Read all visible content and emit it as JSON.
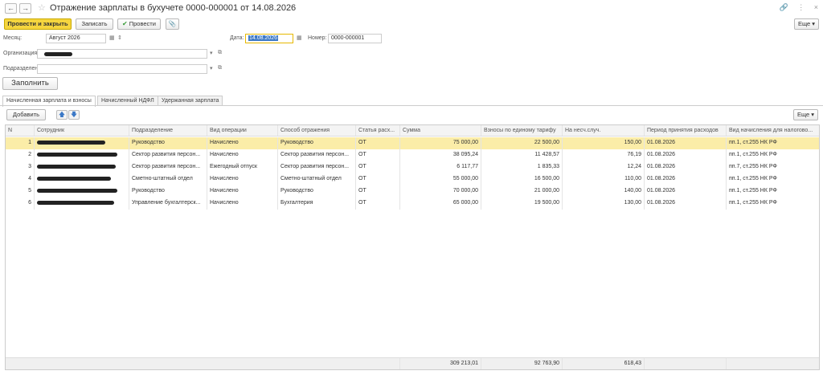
{
  "window": {
    "back": "←",
    "forward": "→",
    "star": "☆",
    "title": "Отражение зарплаты в бухучете 0000-000001 от 14.08.2026",
    "icons": [
      "link-icon",
      "more-icon",
      "close-icon"
    ],
    "link_glyph": "🔗",
    "more_glyph": "⋮",
    "close_glyph": "×"
  },
  "toolbar": {
    "post_close": "Провести и закрыть",
    "save": "Записать",
    "post": "Провести",
    "post_icon": "✔",
    "attach_icon": "📎",
    "more": "Еще",
    "more_arrow": "▾"
  },
  "form": {
    "month_label": "Месяц:",
    "month_value": "Август 2026",
    "date_label": "Дата:",
    "date_value": "14.08.2026",
    "number_label": "Номер:",
    "number_value": "0000-000001",
    "org_label": "Организация:",
    "dept_label": "Подразделение:",
    "fill_button": "Заполнить",
    "calendar_glyph": "▦",
    "dropdown_glyph": "▾",
    "open_glyph": "⧉"
  },
  "tabs": [
    {
      "label": "Начисленная зарплата и взносы"
    },
    {
      "label": "Начисленный НДФЛ"
    },
    {
      "label": "Удержанная зарплата"
    }
  ],
  "table_toolbar": {
    "add": "Добавить",
    "up": "🡅",
    "down": "🡇",
    "more": "Еще",
    "more_arrow": "▾"
  },
  "table": {
    "columns": [
      "N",
      "Сотрудник",
      "Подразделение",
      "Вид операции",
      "Способ отражения",
      "Статья расх...",
      "Сумма",
      "Взносы по единому тарифу",
      "На несч.случ.",
      "Период принятия расходов",
      "Вид начисления для налогово..."
    ],
    "rows": [
      {
        "n": "1",
        "dept": "Руководство",
        "op": "Начислено",
        "method": "Руководство",
        "item": "ОТ",
        "sum": "75 000,00",
        "contrib": "22 500,00",
        "accident": "150,00",
        "period": "01.08.2026",
        "tax": "пп.1, ст.255 НК РФ"
      },
      {
        "n": "2",
        "dept": "Сектор развития персон...",
        "op": "Начислено",
        "method": "Сектор развития персон...",
        "item": "ОТ",
        "sum": "38 095,24",
        "contrib": "11 428,57",
        "accident": "76,19",
        "period": "01.08.2026",
        "tax": "пп.1, ст.255 НК РФ"
      },
      {
        "n": "3",
        "dept": "Сектор развития персон...",
        "op": "Ежегодный отпуск",
        "method": "Сектор развития персон...",
        "item": "ОТ",
        "sum": "6 117,77",
        "contrib": "1 835,33",
        "accident": "12,24",
        "period": "01.08.2026",
        "tax": "пп.7, ст.255 НК РФ"
      },
      {
        "n": "4",
        "dept": "Сметно-штатный отдел",
        "op": "Начислено",
        "method": "Сметно-штатный отдел",
        "item": "ОТ",
        "sum": "55 000,00",
        "contrib": "16 500,00",
        "accident": "110,00",
        "period": "01.08.2026",
        "tax": "пп.1, ст.255 НК РФ"
      },
      {
        "n": "5",
        "dept": "Руководство",
        "op": "Начислено",
        "method": "Руководство",
        "item": "ОТ",
        "sum": "70 000,00",
        "contrib": "21 000,00",
        "accident": "140,00",
        "period": "01.08.2026",
        "tax": "пп.1, ст.255 НК РФ"
      },
      {
        "n": "6",
        "dept": "Управление бухгалтерск...",
        "op": "Начислено",
        "method": "Бухгалтерия",
        "item": "ОТ",
        "sum": "65 000,00",
        "contrib": "19 500,00",
        "accident": "130,00",
        "period": "01.08.2026",
        "tax": "пп.1, ст.255 НК РФ"
      }
    ],
    "totals": {
      "sum": "309 213,01",
      "contrib": "92 763,90",
      "accident": "618,43"
    }
  }
}
